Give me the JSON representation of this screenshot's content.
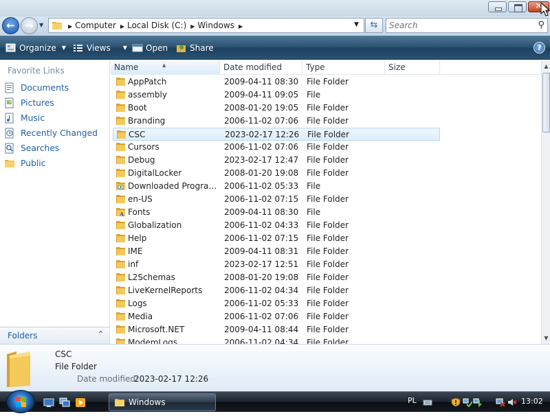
{
  "window": {
    "minimize_icon": "minimize-icon",
    "maximize_icon": "maximize-icon",
    "close_label": "✕"
  },
  "navigation": {
    "back_glyph": "←",
    "forward_glyph": "→",
    "breadcrumb": [
      "Computer",
      "Local Disk (C:)",
      "Windows"
    ],
    "search_placeholder": "Search"
  },
  "toolbar": {
    "organize_label": "Organize",
    "views_label": "Views",
    "open_label": "Open",
    "share_label": "Share",
    "help_label": "?"
  },
  "sidebar": {
    "title": "Favorite Links",
    "items": [
      {
        "label": "Documents",
        "icon": "documents-icon"
      },
      {
        "label": "Pictures",
        "icon": "pictures-icon"
      },
      {
        "label": "Music",
        "icon": "music-icon"
      },
      {
        "label": "Recently Changed",
        "icon": "recently-changed-icon"
      },
      {
        "label": "Searches",
        "icon": "searches-icon"
      },
      {
        "label": "Public",
        "icon": "folder-icon"
      }
    ],
    "folders_label": "Folders"
  },
  "columns": {
    "name": "Name",
    "date": "Date modified",
    "type": "Type",
    "size": "Size"
  },
  "files": [
    {
      "name": "AppPatch",
      "date": "2009-04-11 08:30",
      "type": "File Folder",
      "icon": "folder-icon"
    },
    {
      "name": "assembly",
      "date": "2009-04-11 09:05",
      "type": "File",
      "icon": "folder-icon"
    },
    {
      "name": "Boot",
      "date": "2008-01-20 19:05",
      "type": "File Folder",
      "icon": "folder-icon"
    },
    {
      "name": "Branding",
      "date": "2006-11-02 07:06",
      "type": "File Folder",
      "icon": "folder-icon"
    },
    {
      "name": "CSC",
      "date": "2023-02-17 12:26",
      "type": "File Folder",
      "icon": "folder-icon",
      "selected": true
    },
    {
      "name": "Cursors",
      "date": "2006-11-02 07:06",
      "type": "File Folder",
      "icon": "folder-icon"
    },
    {
      "name": "Debug",
      "date": "2023-02-17 12:47",
      "type": "File Folder",
      "icon": "folder-icon"
    },
    {
      "name": "DigitalLocker",
      "date": "2008-01-20 19:08",
      "type": "File Folder",
      "icon": "folder-icon"
    },
    {
      "name": "Downloaded Program ...",
      "date": "2006-11-02 05:33",
      "type": "File",
      "icon": "system-folder-icon"
    },
    {
      "name": "en-US",
      "date": "2006-11-02 07:15",
      "type": "File Folder",
      "icon": "folder-icon"
    },
    {
      "name": "Fonts",
      "date": "2009-04-11 08:30",
      "type": "File",
      "icon": "fonts-folder-icon"
    },
    {
      "name": "Globalization",
      "date": "2006-11-02 04:33",
      "type": "File Folder",
      "icon": "folder-icon"
    },
    {
      "name": "Help",
      "date": "2006-11-02 07:15",
      "type": "File Folder",
      "icon": "folder-icon"
    },
    {
      "name": "IME",
      "date": "2009-04-11 08:31",
      "type": "File Folder",
      "icon": "folder-icon"
    },
    {
      "name": "inf",
      "date": "2023-02-17 12:51",
      "type": "File Folder",
      "icon": "folder-icon"
    },
    {
      "name": "L2Schemas",
      "date": "2008-01-20 19:08",
      "type": "File Folder",
      "icon": "folder-icon"
    },
    {
      "name": "LiveKernelReports",
      "date": "2006-11-02 04:34",
      "type": "File Folder",
      "icon": "folder-icon"
    },
    {
      "name": "Logs",
      "date": "2006-11-02 05:33",
      "type": "File Folder",
      "icon": "folder-icon"
    },
    {
      "name": "Media",
      "date": "2006-11-02 07:06",
      "type": "File Folder",
      "icon": "folder-icon"
    },
    {
      "name": "Microsoft.NET",
      "date": "2009-04-11 08:44",
      "type": "File Folder",
      "icon": "folder-icon"
    },
    {
      "name": "ModemLogs",
      "date": "2006-11-02 04:34",
      "type": "File Folder",
      "icon": "folder-icon"
    }
  ],
  "details": {
    "name": "CSC",
    "type": "File Folder",
    "date_label": "Date modified:",
    "date_value": "2023-02-17 12:26"
  },
  "taskbar": {
    "task_label": "Windows",
    "language": "PL",
    "time": "13:02"
  },
  "colors": {
    "folder": "#e8b33a",
    "accent": "#1e5fa8",
    "selection": "#dceefc"
  }
}
